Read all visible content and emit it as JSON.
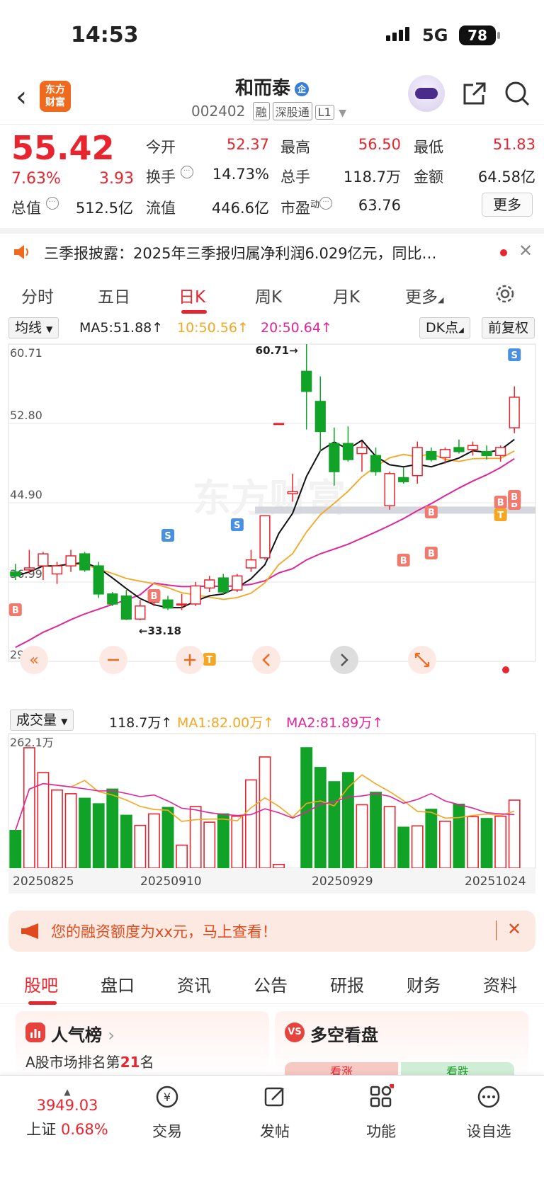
{
  "status_bar": {
    "time": "14:53",
    "network": "5G",
    "battery": "78"
  },
  "header": {
    "name": "和而泰",
    "badge": "企",
    "code": "002402",
    "tags": [
      "融",
      "深股通",
      "L1"
    ],
    "logo_line1": "东方",
    "logo_line2": "财富",
    "icons": [
      "back-icon",
      "robot-avatar",
      "share-icon",
      "search-icon"
    ]
  },
  "quote": {
    "price": "55.42",
    "change_pct": "7.63%",
    "change": "3.93",
    "fields": [
      {
        "label": "今开",
        "value": "52.37",
        "color": "red"
      },
      {
        "label": "最高",
        "value": "56.50",
        "color": "red"
      },
      {
        "label": "最低",
        "value": "51.83",
        "color": "red"
      },
      {
        "label": "换手",
        "value": "14.73%",
        "color": "black"
      },
      {
        "label": "总手",
        "value": "118.7万",
        "color": "black"
      },
      {
        "label": "金额",
        "value": "64.58亿",
        "color": "black"
      },
      {
        "label": "总值",
        "value": "512.5亿",
        "color": "black"
      },
      {
        "label": "流值",
        "value": "446.6亿",
        "color": "black"
      },
      {
        "label": "市盈",
        "value": "63.76",
        "color": "black"
      }
    ],
    "pe_sup": "动",
    "more": "更多"
  },
  "notice": {
    "text": "三季报披露：2025年三季报归属净利润6.029亿元，同比…"
  },
  "tabs": [
    "分时",
    "五日",
    "日K",
    "周K",
    "月K",
    "更多"
  ],
  "active_tab": "日K",
  "ma_row": {
    "selector": "均线",
    "ma5": "MA5:51.88",
    "ma10": "10:50.56",
    "ma20": "20:50.64",
    "dk": "DK点",
    "fq": "前复权"
  },
  "chart_data": {
    "type": "candlestick",
    "y_ticks": [
      "60.71",
      "52.80",
      "44.90",
      "36.99",
      "29.08"
    ],
    "max_label": "60.71",
    "min_label": "33.18",
    "ohlc": [
      [
        38.0,
        38.8,
        37.2,
        37.6
      ],
      [
        38.2,
        40.2,
        37.8,
        38.4
      ],
      [
        38.6,
        40.0,
        37.2,
        39.8
      ],
      [
        37.8,
        39.0,
        36.8,
        38.6
      ],
      [
        38.6,
        40.2,
        38.0,
        39.6
      ],
      [
        39.8,
        40.0,
        38.0,
        38.2
      ],
      [
        38.6,
        39.0,
        35.4,
        35.8
      ],
      [
        35.8,
        36.0,
        34.6,
        34.8
      ],
      [
        35.6,
        36.2,
        33.2,
        33.3
      ],
      [
        33.3,
        35.2,
        33.18,
        34.6
      ],
      [
        35.0,
        35.8,
        34.6,
        35.1
      ],
      [
        35.2,
        35.6,
        34.2,
        34.4
      ],
      [
        34.8,
        35.8,
        34.2,
        34.8
      ],
      [
        34.8,
        37.0,
        34.6,
        36.6
      ],
      [
        36.4,
        37.6,
        36.0,
        37.2
      ],
      [
        37.4,
        37.8,
        35.8,
        36.0
      ],
      [
        36.2,
        37.8,
        36.0,
        37.6
      ],
      [
        38.4,
        40.2,
        38.0,
        39.2
      ],
      [
        39.4,
        43.6,
        39.2,
        43.6
      ],
      [
        52.7,
        52.8,
        52.7,
        52.8
      ],
      [
        45.8,
        47.8,
        45.0,
        46.0
      ],
      [
        58.0,
        60.71,
        52.2,
        56.0
      ],
      [
        55.0,
        57.5,
        50.0,
        52.0
      ],
      [
        50.8,
        52.4,
        46.6,
        48.0
      ],
      [
        50.8,
        52.5,
        49.0,
        49.2
      ],
      [
        49.8,
        51.0,
        48.0,
        50.4
      ],
      [
        49.6,
        50.4,
        47.6,
        48.0
      ],
      [
        44.6,
        48.0,
        44.2,
        47.8
      ],
      [
        47.4,
        48.4,
        46.8,
        47.0
      ],
      [
        47.6,
        51.0,
        46.8,
        50.4
      ],
      [
        50.0,
        50.4,
        49.0,
        49.2
      ],
      [
        49.4,
        50.4,
        48.8,
        50.2
      ],
      [
        50.4,
        51.2,
        49.8,
        50.0
      ],
      [
        50.2,
        51.0,
        49.6,
        50.6
      ],
      [
        50.0,
        50.6,
        49.2,
        49.6
      ],
      [
        49.6,
        50.6,
        49.0,
        50.4
      ],
      [
        52.37,
        56.5,
        51.83,
        55.42
      ]
    ],
    "markers": [
      {
        "i": 1,
        "label": "B",
        "type": "buy"
      },
      {
        "i": 10,
        "label": "B",
        "type": "buy"
      },
      {
        "i": 11,
        "label": "S",
        "type": "sell"
      },
      {
        "i": 14,
        "label": "T",
        "type": "t"
      },
      {
        "i": 16,
        "label": "S",
        "type": "sell"
      },
      {
        "i": 30,
        "label": "B",
        "type": "buy"
      },
      {
        "i": 33,
        "label": "B",
        "type": "buy"
      },
      {
        "i": 34,
        "label": "B",
        "type": "buy"
      },
      {
        "i": 35,
        "label": "T",
        "type": "t"
      },
      {
        "i": 36,
        "label": "B",
        "type": "buy"
      },
      {
        "i": 37,
        "label": "B",
        "type": "buy"
      },
      {
        "i": 38,
        "label": "B",
        "type": "buy"
      },
      {
        "i": 39,
        "label": "S",
        "type": "sell"
      },
      {
        "i": 40,
        "label": "B",
        "type": "buy"
      }
    ],
    "ma5_color": "#111111",
    "ma10_color": "#f5a623",
    "ma20_color": "#e0259a",
    "up_color": "#e8242f",
    "down_color": "#11a327",
    "watermark": "东方财富"
  },
  "chart_controls": [
    "rewind-icon",
    "zoom-out-icon",
    "zoom-in-icon",
    "prev-icon",
    "next-icon",
    "fullscreen-icon"
  ],
  "volume": {
    "selector": "成交量",
    "current": "118.7万",
    "ma1": "MA1:82.00万",
    "ma2": "MA2:81.89万",
    "max_label": "262.1万",
    "dates": [
      "20250825",
      "20250910",
      "20250929",
      "20251024"
    ],
    "values": [
      82,
      262,
      208,
      170,
      162,
      152,
      140,
      172,
      115,
      93,
      118,
      132,
      50,
      134,
      100,
      118,
      113,
      192,
      242,
      8,
      0,
      262,
      219,
      188,
      208,
      138,
      165,
      134,
      89,
      92,
      128,
      102,
      139,
      112,
      108,
      113,
      148
    ]
  },
  "promo": {
    "text": "您的融资额度为xx元，马上查看！"
  },
  "sub_tabs": [
    "股吧",
    "盘口",
    "资讯",
    "公告",
    "研报",
    "财务",
    "资料"
  ],
  "cards": {
    "left_title": "人气榜",
    "left_sub_prefix": "A股市场排名第",
    "left_rank": "21",
    "left_sub_suffix": "名",
    "right_title": "多空看盘",
    "right_up": "看涨",
    "right_down": "看跌"
  },
  "bottom_nav": {
    "index_value": "3949.03",
    "index_name": "上证",
    "index_pct": "0.68%",
    "items": [
      "交易",
      "发帖",
      "功能",
      "设自选"
    ]
  }
}
